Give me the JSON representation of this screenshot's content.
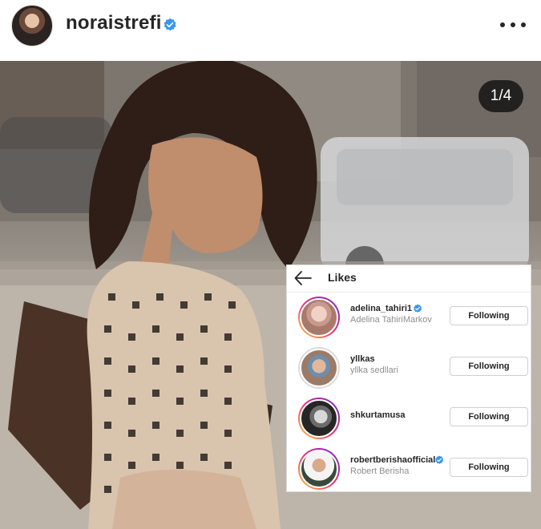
{
  "post": {
    "username": "noraistrefi",
    "verified": true,
    "more_icon": "more-horizontal-icon"
  },
  "media": {
    "counter": "1/4"
  },
  "likes": {
    "title": "Likes",
    "back_icon": "arrow-left-icon",
    "users": [
      {
        "username": "adelina_tahiri1",
        "full_name": "Adelina TahiriMarkov",
        "verified": true,
        "button": "Following",
        "story_ring": true
      },
      {
        "username": "yllkas",
        "full_name": "yllka sedllari",
        "verified": false,
        "button": "Following",
        "story_ring": false
      },
      {
        "username": "shkurtamusa",
        "full_name": "",
        "verified": false,
        "button": "Following",
        "story_ring": true
      },
      {
        "username": "robertberishaofficial",
        "full_name": "Robert Berisha",
        "verified": true,
        "button": "Following",
        "story_ring": true
      }
    ]
  },
  "colors": {
    "verified_blue": "#3897f0",
    "text_primary": "#262626",
    "text_secondary": "#8e8e8e"
  }
}
